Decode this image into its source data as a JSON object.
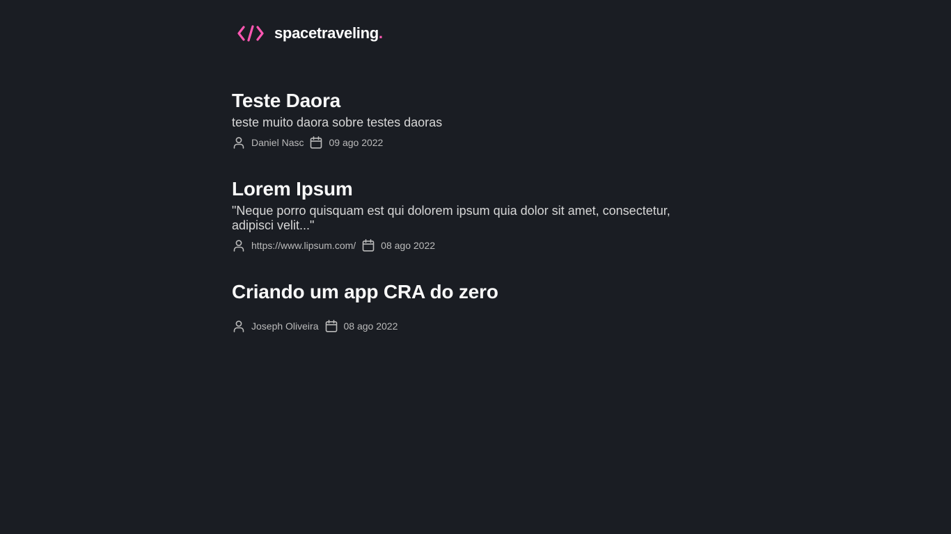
{
  "header": {
    "logo_icon": "code-brackets-icon",
    "logo_text": "spacetraveling",
    "logo_dot": "."
  },
  "colors": {
    "background": "#1a1d23",
    "accent": "#ff57b2",
    "title": "#f8f8f8",
    "subtitle": "#d7d7d7",
    "meta": "#bbbbbb"
  },
  "posts": [
    {
      "title": "Teste Daora",
      "subtitle": "teste muito daora sobre testes daoras",
      "author": "Daniel Nasc",
      "date": "09 ago 2022",
      "author_icon": "user-icon",
      "date_icon": "calendar-icon"
    },
    {
      "title": "Lorem Ipsum",
      "subtitle": "\"Neque porro quisquam est qui dolorem ipsum quia dolor sit amet, consectetur, adipisci velit...\"",
      "author": "https://www.lipsum.com/",
      "date": "08 ago 2022",
      "author_icon": "user-icon",
      "date_icon": "calendar-icon"
    },
    {
      "title": "Criando um app CRA do zero",
      "subtitle": "",
      "author": "Joseph Oliveira",
      "date": "08 ago 2022",
      "author_icon": "user-icon",
      "date_icon": "calendar-icon"
    }
  ]
}
